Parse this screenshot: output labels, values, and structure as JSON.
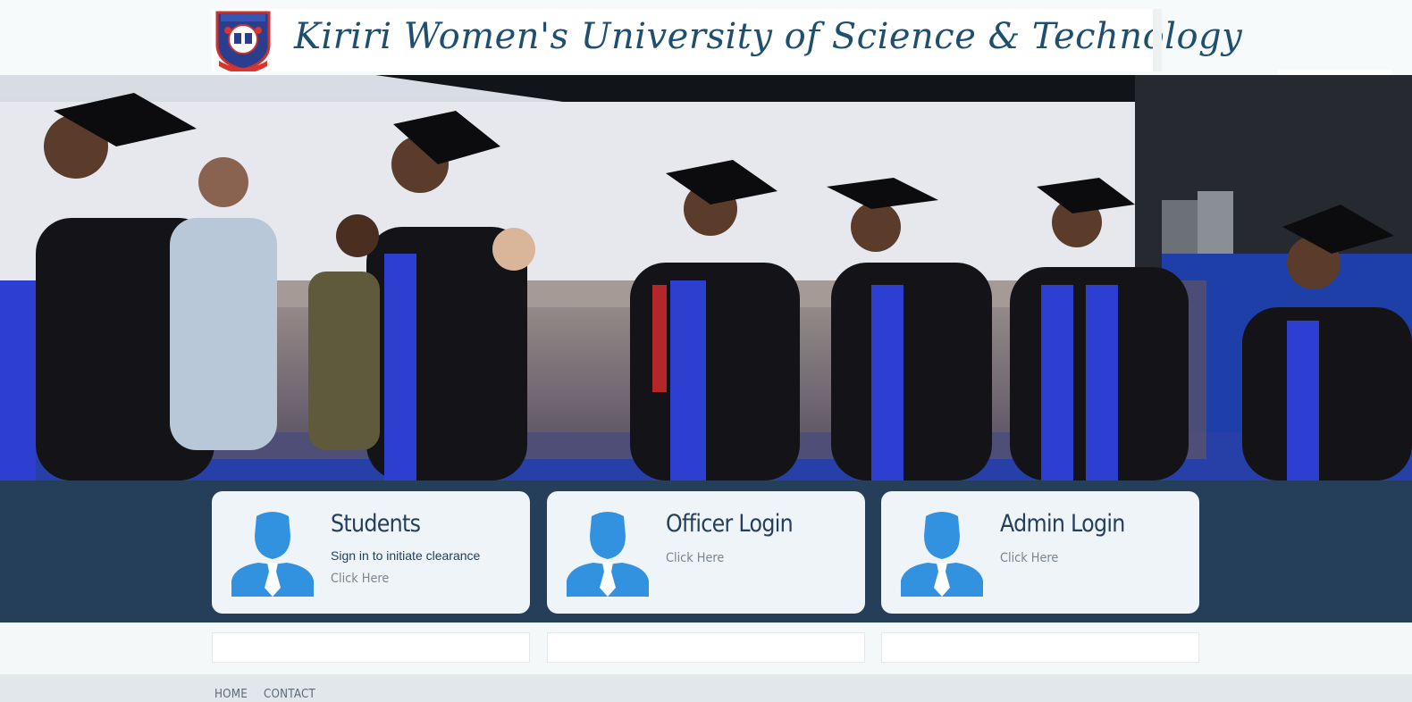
{
  "header": {
    "university_name": "Kiriri Women's University of Science & Technology",
    "crest_icon": "university-crest"
  },
  "hero": {
    "image": "graduation-ceremony-photo"
  },
  "login_cards": [
    {
      "icon": "user-icon",
      "title": "Students",
      "subtitle": "Sign in to initiate clearance",
      "link": "Click Here"
    },
    {
      "icon": "user-icon",
      "title": "Officer Login",
      "link": "Click Here"
    },
    {
      "icon": "user-icon",
      "title": "Admin Login",
      "link": "Click Here"
    }
  ],
  "footer": {
    "nav": [
      "HOME",
      "CONTACT"
    ]
  },
  "colors": {
    "band": "#253f5a",
    "card": "#eef4f7",
    "icon": "#3392e0",
    "title": "#253f5a",
    "muted": "#7a8590"
  }
}
